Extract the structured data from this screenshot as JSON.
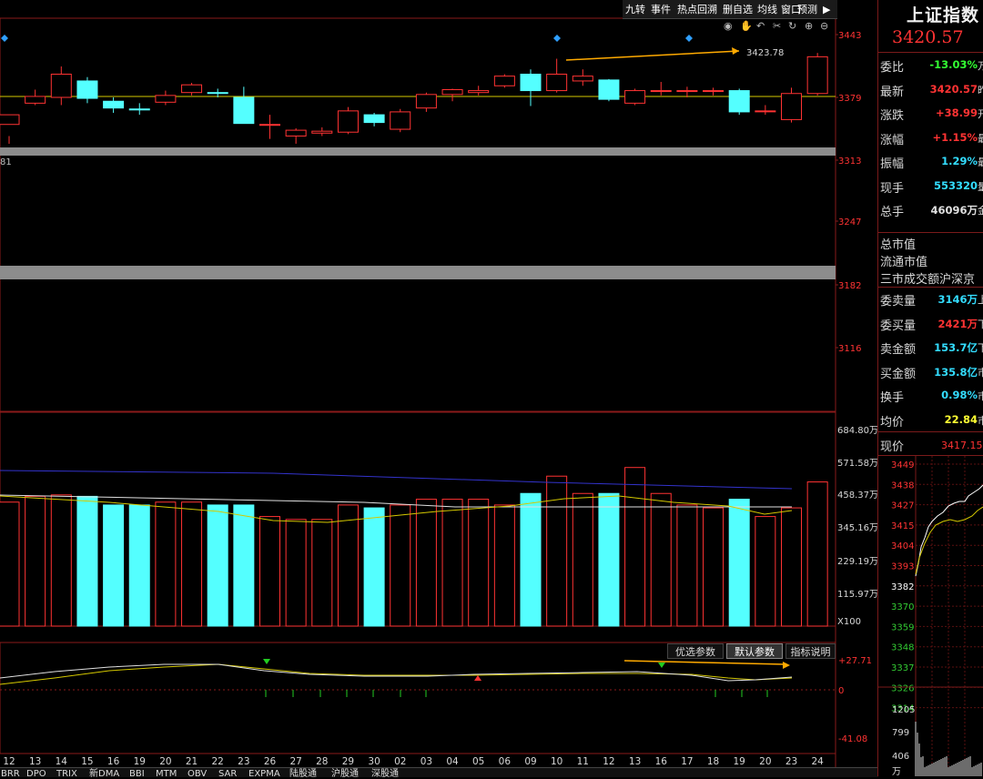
{
  "toolbar": {
    "buttons": [
      "九转",
      "事件",
      "热点回溯",
      "删自选",
      "均线",
      "窗口",
      "预测"
    ],
    "play_label": "▶"
  },
  "price_axis": [
    "3443",
    "3379",
    "3313",
    "3247",
    "3182",
    "3116"
  ],
  "left_edge_label": "81",
  "annotation_price": "3423.78",
  "volume_axis": [
    "684.80万",
    "571.58万",
    "458.37万",
    "345.16万",
    "229.19万",
    "115.97万"
  ],
  "volume_multiplier": "X100",
  "indicator_axis": [
    "27.71",
    "0",
    "-41.08"
  ],
  "indicator_tabs": [
    "优选参数",
    "默认参数",
    "指标说明"
  ],
  "date_labels": [
    "12",
    "13",
    "14",
    "15",
    "16",
    "19",
    "20",
    "21",
    "22",
    "23",
    "26",
    "27",
    "28",
    "29",
    "30",
    "02",
    "03",
    "04",
    "05",
    "06",
    "09",
    "10",
    "11",
    "12",
    "13",
    "16",
    "17",
    "18",
    "19",
    "20",
    "23",
    "24"
  ],
  "bottom_tabs": [
    "BRR",
    "DPO",
    "TRIX",
    "新DMA",
    "BBI",
    "MTM",
    "OBV",
    "SAR",
    "EXPMA",
    "陆股通",
    "沪股通",
    "深股通"
  ],
  "right_panel": {
    "title": "上证指数",
    "price": "3420.57",
    "rows_top": [
      {
        "label": "委比",
        "value": "-13.03%",
        "color": "#33ff33",
        "unit": "万"
      },
      {
        "label": "最新",
        "value": "3420.57",
        "color": "#ff3333",
        "unit": "昨"
      },
      {
        "label": "涨跌",
        "value": "+38.99",
        "color": "#ff3333",
        "unit": "开"
      },
      {
        "label": "涨幅",
        "value": "+1.15%",
        "color": "#ff3333",
        "unit": "最"
      },
      {
        "label": "振幅",
        "value": "1.29%",
        "color": "#33ddff",
        "unit": "最"
      },
      {
        "label": "现手",
        "value": "553320",
        "color": "#33ddff",
        "unit": "量"
      },
      {
        "label": "总手",
        "value": "46096万",
        "color": "#e0e0e0",
        "unit": "金"
      }
    ],
    "market_rows": [
      "总市值",
      "流通市值",
      "三市成交额沪深京"
    ],
    "rows_bottom": [
      {
        "label": "委卖量",
        "value": "3146万",
        "color": "#33ddff",
        "unit": "上"
      },
      {
        "label": "委买量",
        "value": "2421万",
        "color": "#ff3333",
        "unit": "下"
      },
      {
        "label": "卖金额",
        "value": "153.7亿",
        "color": "#33ddff",
        "unit": "下"
      },
      {
        "label": "买金额",
        "value": "135.8亿",
        "color": "#33ddff",
        "unit": "市"
      },
      {
        "label": "换手",
        "value": "0.98%",
        "color": "#33ddff",
        "unit": "市"
      },
      {
        "label": "均价",
        "value": "22.84",
        "color": "#ffff33",
        "unit": "市"
      }
    ],
    "current_label": "现价",
    "current_value": "3417.15",
    "mini_axis": [
      "3449",
      "3438",
      "3427",
      "3415",
      "3404",
      "3393",
      "3382",
      "3370",
      "3359",
      "3348",
      "3337",
      "3326",
      "3314"
    ],
    "mini_vol_axis": [
      "1205",
      "799",
      "406",
      "万"
    ]
  },
  "chart_data": {
    "type": "candlestick",
    "categories": [
      "12",
      "13",
      "14",
      "15",
      "16",
      "19",
      "20",
      "21",
      "22",
      "23",
      "26",
      "27",
      "28",
      "29",
      "30",
      "02",
      "03",
      "04",
      "05",
      "06",
      "09",
      "10",
      "11",
      "12",
      "13",
      "16",
      "17",
      "18",
      "19",
      "20",
      "23",
      "24"
    ],
    "ohlc": [
      [
        3350,
        3360,
        3338,
        3330
      ],
      [
        3372,
        3379,
        3386,
        3370
      ],
      [
        3378,
        3402,
        3410,
        3370
      ],
      [
        3395,
        3377,
        3399,
        3372
      ],
      [
        3374,
        3367,
        3378,
        3362
      ],
      [
        3366,
        3365,
        3372,
        3360
      ],
      [
        3373,
        3380,
        3385,
        3370
      ],
      [
        3383,
        3391,
        3393,
        3380
      ],
      [
        3383,
        3382,
        3387,
        3378
      ],
      [
        3378,
        3351,
        3389,
        3351
      ],
      [
        3350,
        3350,
        3360,
        3335
      ],
      [
        3338,
        3344,
        3346,
        3330
      ],
      [
        3341,
        3343,
        3347,
        3338
      ],
      [
        3342,
        3364,
        3368,
        3340
      ],
      [
        3360,
        3352,
        3362,
        3348
      ],
      [
        3345,
        3363,
        3366,
        3342
      ],
      [
        3367,
        3381,
        3383,
        3363
      ],
      [
        3381,
        3386,
        3387,
        3374
      ],
      [
        3383,
        3385,
        3390,
        3380
      ],
      [
        3390,
        3400,
        3402,
        3388
      ],
      [
        3402,
        3385,
        3407,
        3369
      ],
      [
        3385,
        3402,
        3418,
        3383
      ],
      [
        3395,
        3400,
        3407,
        3390
      ],
      [
        3396,
        3376,
        3397,
        3374
      ],
      [
        3372,
        3385,
        3387,
        3370
      ],
      [
        3385,
        3385,
        3394,
        3380
      ],
      [
        3385,
        3385,
        3389,
        3378
      ],
      [
        3385,
        3385,
        3388,
        3380
      ],
      [
        3385,
        3363,
        3387,
        3360
      ],
      [
        3364,
        3364,
        3370,
        3360
      ],
      [
        3355,
        3382,
        3388,
        3352
      ],
      [
        3382,
        3420,
        3424,
        3380
      ]
    ],
    "volume": [
      430,
      450,
      455,
      450,
      420,
      420,
      430,
      430,
      420,
      420,
      380,
      370,
      370,
      420,
      410,
      420,
      440,
      440,
      440,
      420,
      460,
      520,
      460,
      460,
      550,
      460,
      420,
      410,
      440,
      380,
      410,
      500
    ],
    "volume_unit": "万 X100",
    "hline": 3379,
    "ylim_price": [
      3116,
      3443
    ],
    "ylim_volume": [
      0,
      684.8
    ]
  }
}
